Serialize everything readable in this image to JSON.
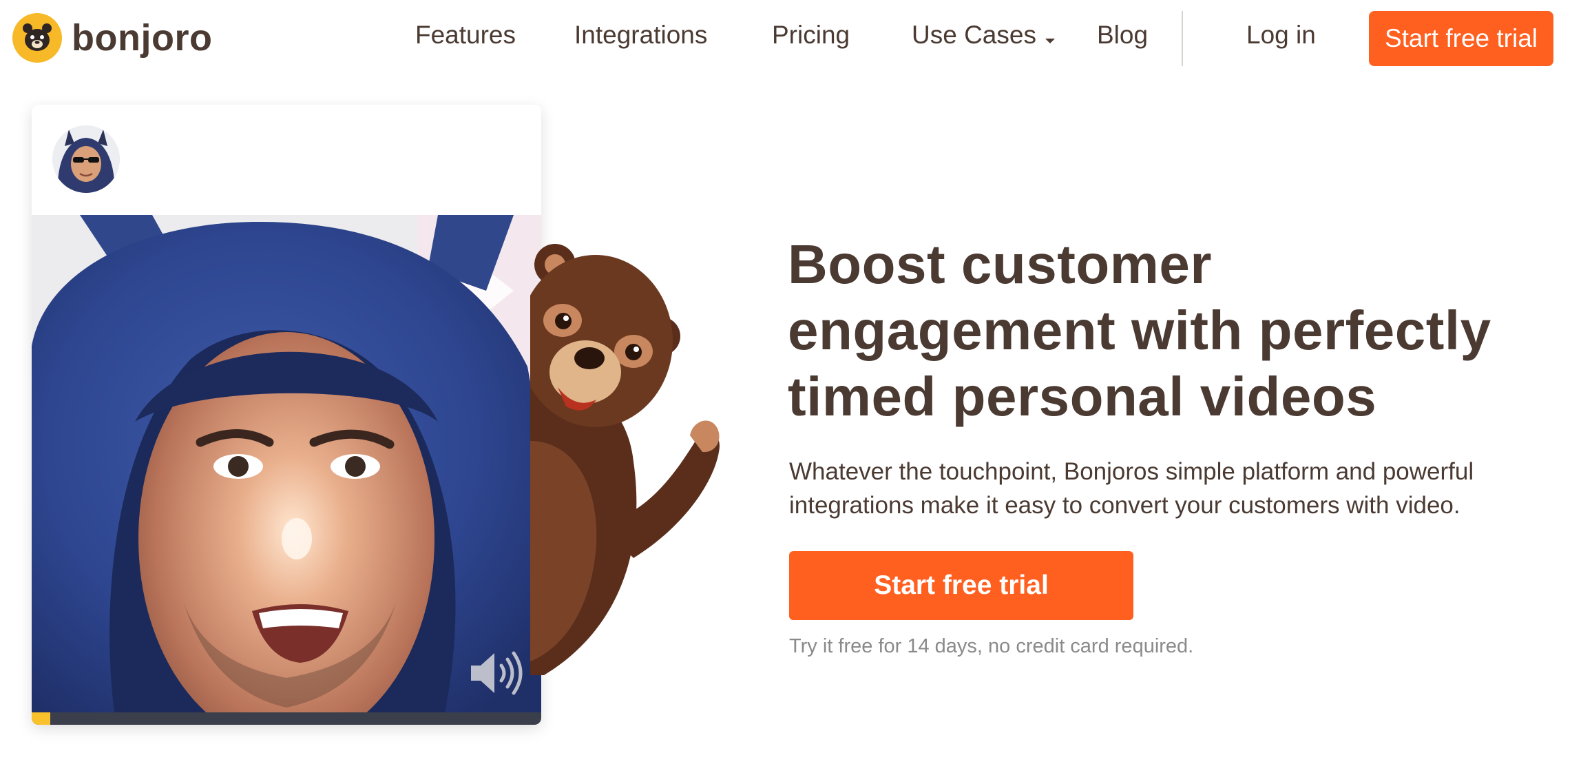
{
  "brand": {
    "name": "bonjoro",
    "accent_color": "#ff5f1f",
    "logo_color": "#f7b928",
    "text_color": "#4a3a32",
    "logo_icon": "bear-face-icon"
  },
  "nav": {
    "items": [
      {
        "label": "Features"
      },
      {
        "label": "Integrations"
      },
      {
        "label": "Pricing"
      },
      {
        "label": "Use Cases",
        "icon": "chevron-down-icon"
      },
      {
        "label": "Blog"
      }
    ],
    "login_label": "Log in",
    "cta_label": "Start free trial"
  },
  "video_card": {
    "volume_icon": "volume-icon",
    "progress_fraction": 0.036,
    "progress_color": "#f9c12c"
  },
  "hero": {
    "title_lines": [
      "Boost customer",
      "engagement with perfectly",
      "timed personal videos"
    ],
    "subtitle_lines": [
      "Whatever the touchpoint, Bonjoros simple platform and powerful",
      "integrations make it easy to convert your customers with video."
    ],
    "cta_label": "Start free trial",
    "note": "Try it free for 14 days, no credit card required."
  }
}
